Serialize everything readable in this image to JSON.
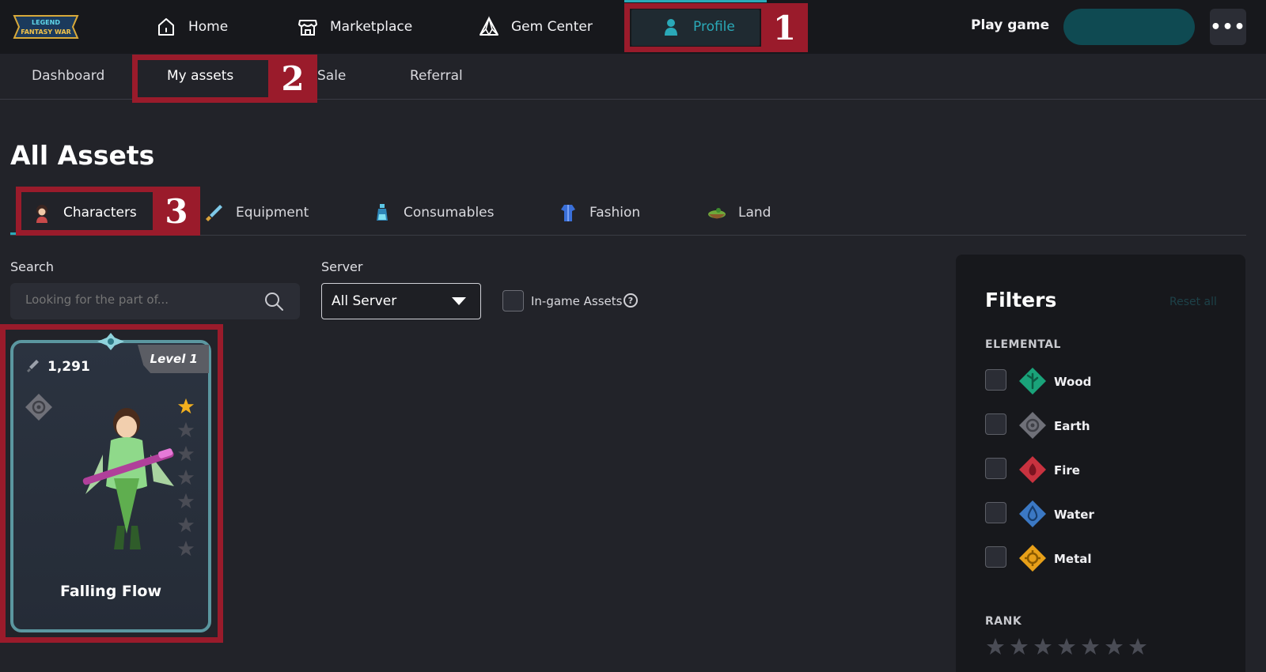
{
  "nav": {
    "home": "Home",
    "marketplace": "Marketplace",
    "gem_center": "Gem Center",
    "profile": "Profile",
    "play_game": "Play game",
    "more": "•••"
  },
  "logo": {
    "line1": "LEGEND",
    "line2": "FANTASY WAR"
  },
  "subnav": {
    "dashboard": "Dashboard",
    "my_assets": "My assets",
    "sale": "Sale",
    "referral": "Referral"
  },
  "annotations": {
    "one": "1",
    "two": "2",
    "three": "3"
  },
  "page_title": "All Assets",
  "tabs": {
    "characters": "Characters",
    "equipment": "Equipment",
    "consumables": "Consumables",
    "fashion": "Fashion",
    "land": "Land"
  },
  "search": {
    "label": "Search",
    "placeholder": "Looking for the part of..."
  },
  "server": {
    "label": "Server",
    "value": "All Server"
  },
  "ingame": {
    "label": "In-game Assets",
    "help": "?"
  },
  "card": {
    "level": "Level 1",
    "power": "1,291",
    "name": "Falling Flow",
    "stars_filled": 1,
    "stars_total": 7,
    "element_icon": "earth-icon"
  },
  "filters": {
    "title": "Filters",
    "reset": "Reset all",
    "elemental_label": "ELEMENTAL",
    "rank_label": "RANK",
    "elements": [
      {
        "label": "Wood",
        "color": "#1aa37a",
        "icon": "wood-icon"
      },
      {
        "label": "Earth",
        "color": "#6f7078",
        "icon": "earth-icon"
      },
      {
        "label": "Fire",
        "color": "#c8323f",
        "icon": "fire-icon"
      },
      {
        "label": "Water",
        "color": "#3b78c4",
        "icon": "water-icon"
      },
      {
        "label": "Metal",
        "color": "#e8a019",
        "icon": "metal-icon"
      }
    ]
  },
  "colors": {
    "accent": "#2aa9b8",
    "annotation": "#9a1b2b",
    "connect_button": "#0f4a52",
    "star_active": "#f2b01e",
    "star_inactive": "#4a4c55"
  }
}
